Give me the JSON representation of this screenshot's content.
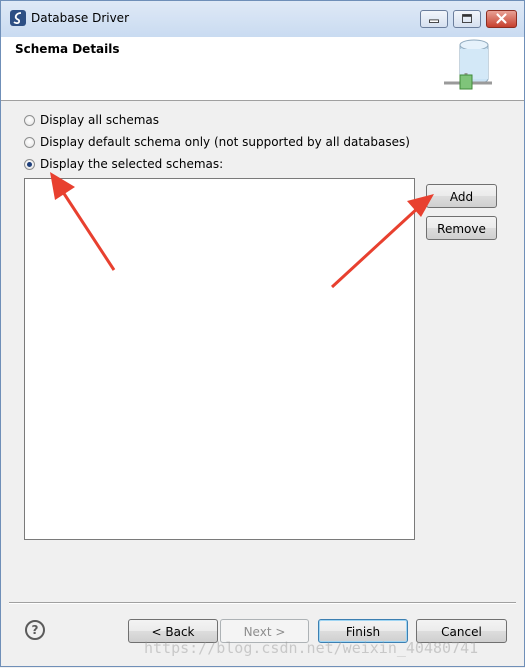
{
  "window": {
    "title": "Database Driver",
    "icons": {
      "app": "eclipse-data-tools-icon",
      "minimize": "minimize-icon",
      "maximize": "maximize-icon",
      "close": "close-icon"
    }
  },
  "header": {
    "title": "Schema Details",
    "icon": "database-connection-icon"
  },
  "options": [
    {
      "label": "Display all schemas",
      "checked": false
    },
    {
      "label": "Display default schema only (not supported by all databases)",
      "checked": false
    },
    {
      "label": "Display the selected schemas:",
      "checked": true
    }
  ],
  "schema_list": {
    "items": []
  },
  "side_buttons": {
    "add": "Add",
    "remove": "Remove"
  },
  "footer": {
    "help_icon": "help-icon",
    "help_glyph": "?",
    "back": "< Back",
    "next": "Next >",
    "finish": "Finish",
    "cancel": "Cancel"
  },
  "watermark": "https://blog.csdn.net/weixin_40480741",
  "colors": {
    "annotation_arrow": "#e8402f",
    "title_bar": "#c9dbf1",
    "default_button_border": "#3c7fb1"
  }
}
